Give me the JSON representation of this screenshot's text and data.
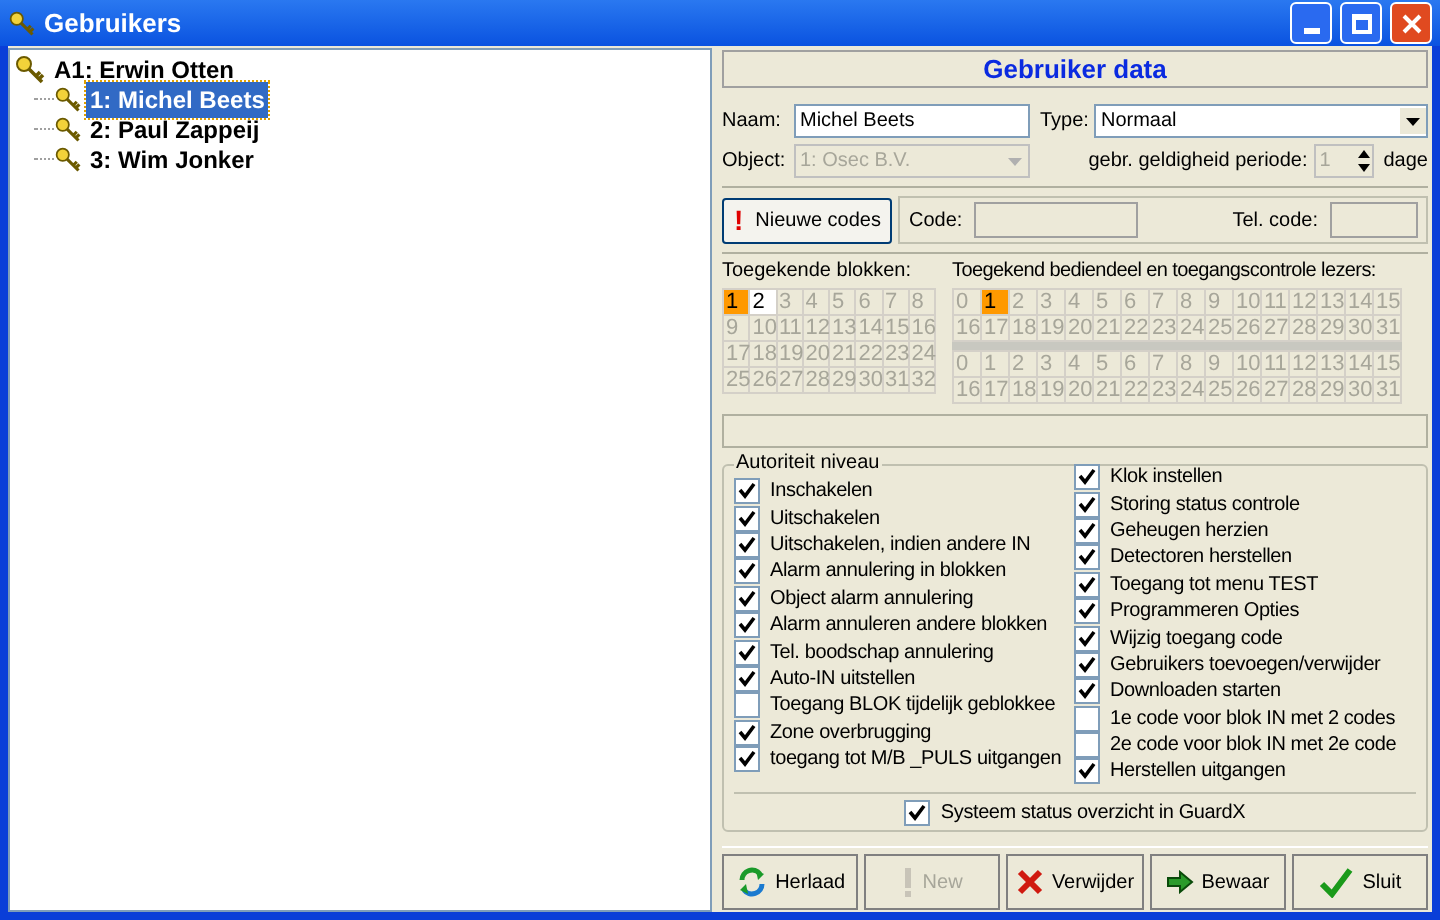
{
  "window": {
    "title": "Gebruikers"
  },
  "tree": {
    "label": "A1: Erwin Otten",
    "expanded": true,
    "children": [
      {
        "label": "1: Michel Beets",
        "selected": true
      },
      {
        "label": "2: Paul Zappeij",
        "selected": false
      },
      {
        "label": "3: Wim Jonker",
        "selected": false
      }
    ]
  },
  "panel_title": "Gebruiker data",
  "naam": {
    "label": "Naam:",
    "value": "Michel Beets"
  },
  "type": {
    "label": "Type:",
    "value": "Normaal"
  },
  "object": {
    "label": "Object:",
    "value": "1: Osec B.V.",
    "disabled": true
  },
  "period": {
    "label": "gebr. geldigheid periode:",
    "value": "1",
    "unit": "dage",
    "disabled": true
  },
  "new_codes_button": {
    "icon": "!",
    "label": "Nieuwe codes"
  },
  "code": {
    "label": "Code:"
  },
  "tel_code": {
    "label": "Tel. code:"
  },
  "blocks": {
    "label": "Toegekende blokken:",
    "cells": [
      {
        "label": "1",
        "selected": true,
        "disabled": false
      },
      {
        "label": "2",
        "selected": false,
        "disabled": false
      },
      {
        "label": "3",
        "selected": false,
        "disabled": true
      },
      {
        "label": "4",
        "selected": false,
        "disabled": true
      },
      {
        "label": "5",
        "selected": false,
        "disabled": true
      },
      {
        "label": "6",
        "selected": false,
        "disabled": true
      },
      {
        "label": "7",
        "selected": false,
        "disabled": true
      },
      {
        "label": "8",
        "selected": false,
        "disabled": true
      },
      {
        "label": "9",
        "selected": false,
        "disabled": true
      },
      {
        "label": "10",
        "selected": false,
        "disabled": true
      },
      {
        "label": "11",
        "selected": false,
        "disabled": true
      },
      {
        "label": "12",
        "selected": false,
        "disabled": true
      },
      {
        "label": "13",
        "selected": false,
        "disabled": true
      },
      {
        "label": "14",
        "selected": false,
        "disabled": true
      },
      {
        "label": "15",
        "selected": false,
        "disabled": true
      },
      {
        "label": "16",
        "selected": false,
        "disabled": true
      },
      {
        "label": "17",
        "selected": false,
        "disabled": true
      },
      {
        "label": "18",
        "selected": false,
        "disabled": true
      },
      {
        "label": "19",
        "selected": false,
        "disabled": true
      },
      {
        "label": "20",
        "selected": false,
        "disabled": true
      },
      {
        "label": "21",
        "selected": false,
        "disabled": true
      },
      {
        "label": "22",
        "selected": false,
        "disabled": true
      },
      {
        "label": "23",
        "selected": false,
        "disabled": true
      },
      {
        "label": "24",
        "selected": false,
        "disabled": true
      },
      {
        "label": "25",
        "selected": false,
        "disabled": true
      },
      {
        "label": "26",
        "selected": false,
        "disabled": true
      },
      {
        "label": "27",
        "selected": false,
        "disabled": true
      },
      {
        "label": "28",
        "selected": false,
        "disabled": true
      },
      {
        "label": "29",
        "selected": false,
        "disabled": true
      },
      {
        "label": "30",
        "selected": false,
        "disabled": true
      },
      {
        "label": "31",
        "selected": false,
        "disabled": true
      },
      {
        "label": "32",
        "selected": false,
        "disabled": true
      }
    ]
  },
  "readers": {
    "label": "Toegekend bediendeel en toegangscontrole lezers:",
    "groups": [
      {
        "cells": [
          {
            "label": "0",
            "selected": false
          },
          {
            "label": "1",
            "selected": true
          },
          {
            "label": "2",
            "selected": false
          },
          {
            "label": "3",
            "selected": false
          },
          {
            "label": "4",
            "selected": false
          },
          {
            "label": "5",
            "selected": false
          },
          {
            "label": "6",
            "selected": false
          },
          {
            "label": "7",
            "selected": false
          },
          {
            "label": "8",
            "selected": false
          },
          {
            "label": "9",
            "selected": false
          },
          {
            "label": "10",
            "selected": false
          },
          {
            "label": "11",
            "selected": false
          },
          {
            "label": "12",
            "selected": false
          },
          {
            "label": "13",
            "selected": false
          },
          {
            "label": "14",
            "selected": false
          },
          {
            "label": "15",
            "selected": false
          },
          {
            "label": "16",
            "selected": false
          },
          {
            "label": "17",
            "selected": false
          },
          {
            "label": "18",
            "selected": false
          },
          {
            "label": "19",
            "selected": false
          },
          {
            "label": "20",
            "selected": false
          },
          {
            "label": "21",
            "selected": false
          },
          {
            "label": "22",
            "selected": false
          },
          {
            "label": "23",
            "selected": false
          },
          {
            "label": "24",
            "selected": false
          },
          {
            "label": "25",
            "selected": false
          },
          {
            "label": "26",
            "selected": false
          },
          {
            "label": "27",
            "selected": false
          },
          {
            "label": "28",
            "selected": false
          },
          {
            "label": "29",
            "selected": false
          },
          {
            "label": "30",
            "selected": false
          },
          {
            "label": "31",
            "selected": false
          }
        ]
      },
      {
        "cells": [
          {
            "label": "0",
            "selected": false
          },
          {
            "label": "1",
            "selected": false
          },
          {
            "label": "2",
            "selected": false
          },
          {
            "label": "3",
            "selected": false
          },
          {
            "label": "4",
            "selected": false
          },
          {
            "label": "5",
            "selected": false
          },
          {
            "label": "6",
            "selected": false
          },
          {
            "label": "7",
            "selected": false
          },
          {
            "label": "8",
            "selected": false
          },
          {
            "label": "9",
            "selected": false
          },
          {
            "label": "10",
            "selected": false
          },
          {
            "label": "11",
            "selected": false
          },
          {
            "label": "12",
            "selected": false
          },
          {
            "label": "13",
            "selected": false
          },
          {
            "label": "14",
            "selected": false
          },
          {
            "label": "15",
            "selected": false
          },
          {
            "label": "16",
            "selected": false
          },
          {
            "label": "17",
            "selected": false
          },
          {
            "label": "18",
            "selected": false
          },
          {
            "label": "19",
            "selected": false
          },
          {
            "label": "20",
            "selected": false
          },
          {
            "label": "21",
            "selected": false
          },
          {
            "label": "22",
            "selected": false
          },
          {
            "label": "23",
            "selected": false
          },
          {
            "label": "24",
            "selected": false
          },
          {
            "label": "25",
            "selected": false
          },
          {
            "label": "26",
            "selected": false
          },
          {
            "label": "27",
            "selected": false
          },
          {
            "label": "28",
            "selected": false
          },
          {
            "label": "29",
            "selected": false
          },
          {
            "label": "30",
            "selected": false
          },
          {
            "label": "31",
            "selected": false
          }
        ]
      }
    ]
  },
  "authority": {
    "title": "Autoriteit niveau",
    "left": [
      {
        "label": "Inschakelen",
        "checked": true
      },
      {
        "label": "Uitschakelen",
        "checked": true
      },
      {
        "label": "Uitschakelen, indien andere IN",
        "checked": true
      },
      {
        "label": "Alarm annulering in blokken",
        "checked": true
      },
      {
        "label": "Object alarm annulering",
        "checked": true
      },
      {
        "label": "Alarm annuleren andere blokken",
        "checked": true
      },
      {
        "label": "Tel. boodschap annulering",
        "checked": true
      },
      {
        "label": "Auto-IN uitstellen",
        "checked": true
      },
      {
        "label": "Toegang BLOK tijdelijk geblokkee",
        "checked": false
      },
      {
        "label": "Zone overbrugging",
        "checked": true
      },
      {
        "label": "toegang tot M/B _PULS uitgangen",
        "checked": true
      }
    ],
    "right": [
      {
        "label": "Klok instellen",
        "checked": true
      },
      {
        "label": "Storing status controle",
        "checked": true
      },
      {
        "label": "Geheugen herzien",
        "checked": true
      },
      {
        "label": "Detectoren herstellen",
        "checked": true
      },
      {
        "label": "Toegang tot menu TEST",
        "checked": true
      },
      {
        "label": "Programmeren Opties",
        "checked": true
      },
      {
        "label": "Wijzig toegang code",
        "checked": true
      },
      {
        "label": "Gebruikers toevoegen/verwijder",
        "checked": true
      },
      {
        "label": "Downloaden starten",
        "checked": true
      },
      {
        "label": "1e code voor blok IN met 2 codes",
        "checked": false
      },
      {
        "label": "2e code voor blok IN met 2e code",
        "checked": false
      },
      {
        "label": "Herstellen uitgangen",
        "checked": true
      }
    ],
    "system": {
      "label": "Systeem status overzicht in GuardX",
      "checked": true
    }
  },
  "buttons": [
    {
      "kind": "reload",
      "label": "Herlaad",
      "disabled": false
    },
    {
      "kind": "new",
      "label": "New",
      "disabled": true
    },
    {
      "kind": "delete",
      "label": "Verwijder",
      "disabled": false
    },
    {
      "kind": "save",
      "label": "Bewaar",
      "disabled": false
    },
    {
      "kind": "close",
      "label": "Sluit",
      "disabled": false
    }
  ]
}
